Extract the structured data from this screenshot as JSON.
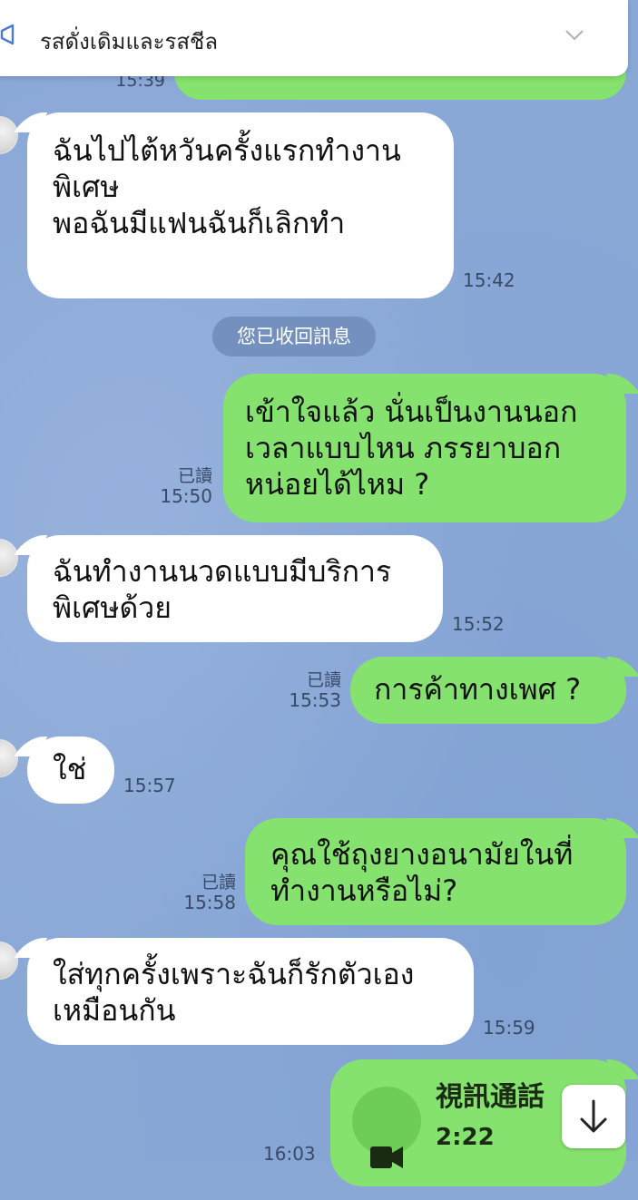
{
  "banner": {
    "text": "รสดั่งเดิมและรสชีล"
  },
  "top_time": "15:39",
  "system_notice": "您已收回訊息",
  "messages": [
    {
      "side": "in",
      "text": "ฉันไปไต้หวันครั้งแรกทำงาน\nพิเศษ\nพอฉันมีแฟนฉันก็เลิกทำ",
      "time": "15:42"
    },
    {
      "side": "out",
      "text": "เข้าใจแล้ว นั่นเป็นงานนอก\nเวลาแบบไหน ภรรยาบอก\nหน่อยได้ไหม ?",
      "read": "已讀",
      "time": "15:50"
    },
    {
      "side": "in",
      "text": "ฉันทำงานนวดแบบมีบริการ\nพิเศษด้วย",
      "time": "15:52"
    },
    {
      "side": "out",
      "text": "การค้าทางเพศ ?",
      "read": "已讀",
      "time": "15:53"
    },
    {
      "side": "in",
      "text": "ใช่",
      "time": "15:57"
    },
    {
      "side": "out",
      "text": "คุณใช้ถุงยางอนามัยในที่\nทำงานหรือไม่?",
      "read": "已讀",
      "time": "15:58"
    },
    {
      "side": "in",
      "text": "ใส่ทุกครั้งเพราะฉันก็รักตัวเอง\nเหมือนกัน",
      "time": "15:59"
    }
  ],
  "video_call": {
    "title": "視訊通話",
    "duration": "2:22",
    "time": "16:03",
    "icon": "video-camera-icon"
  },
  "colors": {
    "background": "#8aa8d6",
    "incoming_bubble": "#ffffff",
    "outgoing_bubble": "#86e26e",
    "system_pill": "#7390be"
  }
}
